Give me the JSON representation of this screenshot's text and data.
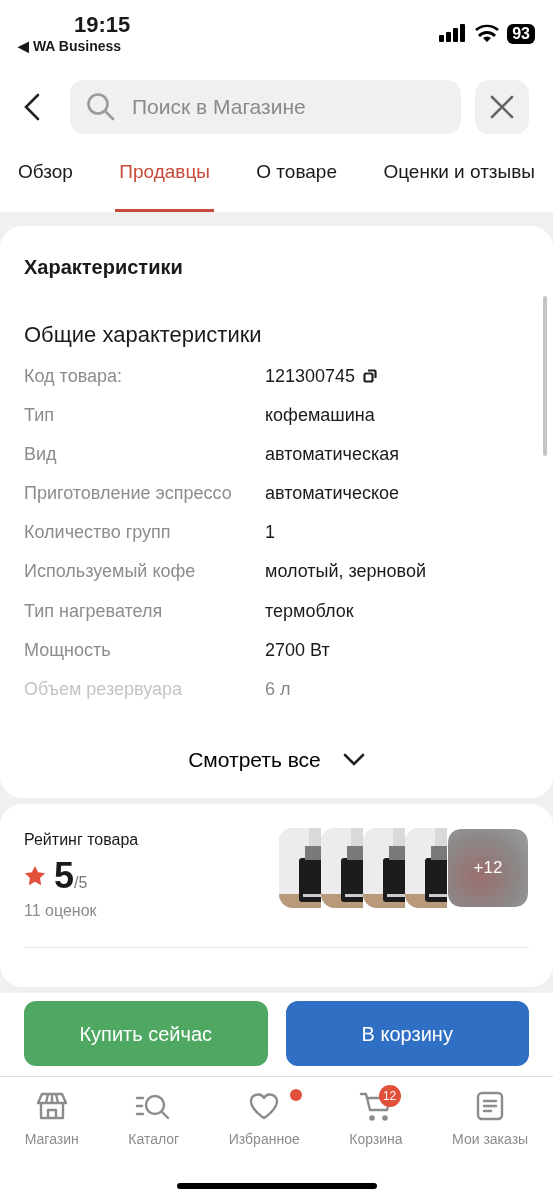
{
  "status_bar": {
    "time": "19:15",
    "back_app": "◀ WA Business",
    "battery": "93"
  },
  "search": {
    "placeholder": "Поиск в Магазине"
  },
  "tabs": [
    {
      "label": "Обзор",
      "selected": false
    },
    {
      "label": "Продавцы",
      "selected": true
    },
    {
      "label": "О товаре",
      "selected": false
    },
    {
      "label": "Оценки и отзывы",
      "selected": false
    }
  ],
  "specs": {
    "title": "Характеристики",
    "group": "Общие характеристики",
    "rows": [
      {
        "label": "Код товара:",
        "value": "121300745",
        "copy": true
      },
      {
        "label": "Тип",
        "value": "кофемашина",
        "copy": false
      },
      {
        "label": "Вид",
        "value": "автоматическая",
        "copy": false
      },
      {
        "label": "Приготовление эспрессо",
        "value": "автоматическое",
        "copy": false
      },
      {
        "label": "Количество групп",
        "value": "1",
        "copy": false
      },
      {
        "label": "Используемый кофе",
        "value": "молотый, зерновой",
        "copy": false
      },
      {
        "label": "Тип нагревателя",
        "value": "термоблок",
        "copy": false
      },
      {
        "label": "Мощность",
        "value": "2700 Вт",
        "copy": false
      },
      {
        "label": "Объем резервуара",
        "value": "6 л",
        "copy": false
      }
    ],
    "show_all": "Смотреть все"
  },
  "rating": {
    "title": "Рейтинг товара",
    "score": "5",
    "out_of": "/5",
    "count": "11 оценок",
    "more_photos": "+12"
  },
  "actions": {
    "buy": "Купить сейчас",
    "cart": "В корзину"
  },
  "nav": [
    {
      "label": "Магазин",
      "dot": false
    },
    {
      "label": "Каталог",
      "dot": false
    },
    {
      "label": "Избранное",
      "dot": true
    },
    {
      "label": "Корзина",
      "dot": false,
      "badge": "12"
    },
    {
      "label": "Мои заказы",
      "dot": false
    }
  ]
}
